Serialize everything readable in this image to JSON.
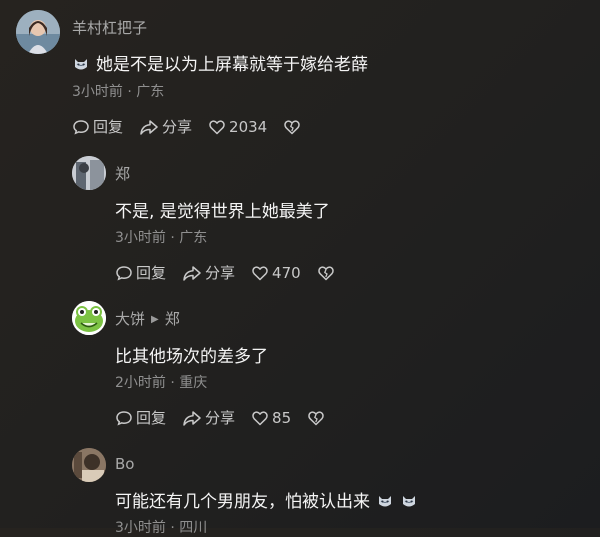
{
  "comments": [
    {
      "username": "羊村杠把子",
      "text": "她是不是以为上屏幕就等于嫁给老薛",
      "meta": "3小时前 · 广东",
      "reply_label": "回复",
      "share_label": "分享",
      "like_count": "2034",
      "leading_emoji": "cat-face-emoji"
    },
    {
      "username": "郑",
      "text": "不是, 是觉得世界上她最美了",
      "meta": "3小时前 · 广东",
      "reply_label": "回复",
      "share_label": "分享",
      "like_count": "470"
    },
    {
      "username": "大饼",
      "reply_to": "郑",
      "text": "比其他场次的差多了",
      "meta": "2小时前 · 重庆",
      "reply_label": "回复",
      "share_label": "分享",
      "like_count": "85"
    },
    {
      "username": "Bo",
      "text": "可能还有几个男朋友，怕被认出来",
      "meta": "3小时前 · 四川",
      "trailing_emojis": [
        "cat-face-emoji",
        "cat-face-emoji"
      ]
    }
  ],
  "colors": {
    "background": "#242220",
    "username": "#a9a9a9",
    "text": "#f4f4f4",
    "meta": "#8f8f8f",
    "action": "#c8c8c8"
  }
}
